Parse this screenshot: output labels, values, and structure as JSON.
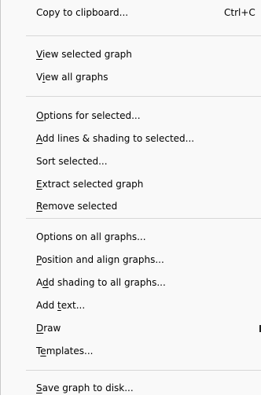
{
  "menu": {
    "items": [
      {
        "id": "copy-to-clipboard",
        "before": "",
        "access": "",
        "after": "Copy to clipboard...",
        "shortcut": "Ctrl+C"
      },
      {
        "id": "view-selected-graph",
        "before": "",
        "access": "V",
        "after": "iew selected graph"
      },
      {
        "id": "view-all-graphs",
        "before": "V",
        "access": "i",
        "after": "ew all graphs"
      },
      {
        "id": "options-for-selected",
        "before": "",
        "access": "O",
        "after": "ptions for selected..."
      },
      {
        "id": "add-lines-shading-selected",
        "before": "",
        "access": "A",
        "after": "dd lines & shading to selected..."
      },
      {
        "id": "sort-selected",
        "before": "Sort selected...",
        "access": "",
        "after": ""
      },
      {
        "id": "extract-selected-graph",
        "before": "",
        "access": "E",
        "after": "xtract selected graph"
      },
      {
        "id": "remove-selected",
        "before": "",
        "access": "R",
        "after": "emove selected"
      },
      {
        "id": "options-on-all-graphs",
        "before": "Options on all graphs...",
        "access": "",
        "after": ""
      },
      {
        "id": "position-align-graphs",
        "before": "",
        "access": "P",
        "after": "osition and align graphs..."
      },
      {
        "id": "add-shading-all-graphs",
        "before": "A",
        "access": "d",
        "after": "d shading to all graphs..."
      },
      {
        "id": "add-text",
        "before": "Add ",
        "access": "t",
        "after": "ext..."
      },
      {
        "id": "draw",
        "before": "",
        "access": "D",
        "after": "raw"
      },
      {
        "id": "templates",
        "before": "T",
        "access": "e",
        "after": "mplates..."
      },
      {
        "id": "save-graph-to-disk",
        "before": "",
        "access": "S",
        "after": "ave graph to disk..."
      }
    ]
  },
  "colors": {
    "menu_background": "#f9f9f9",
    "separator": "#d7d7d7",
    "text": "#000000"
  }
}
